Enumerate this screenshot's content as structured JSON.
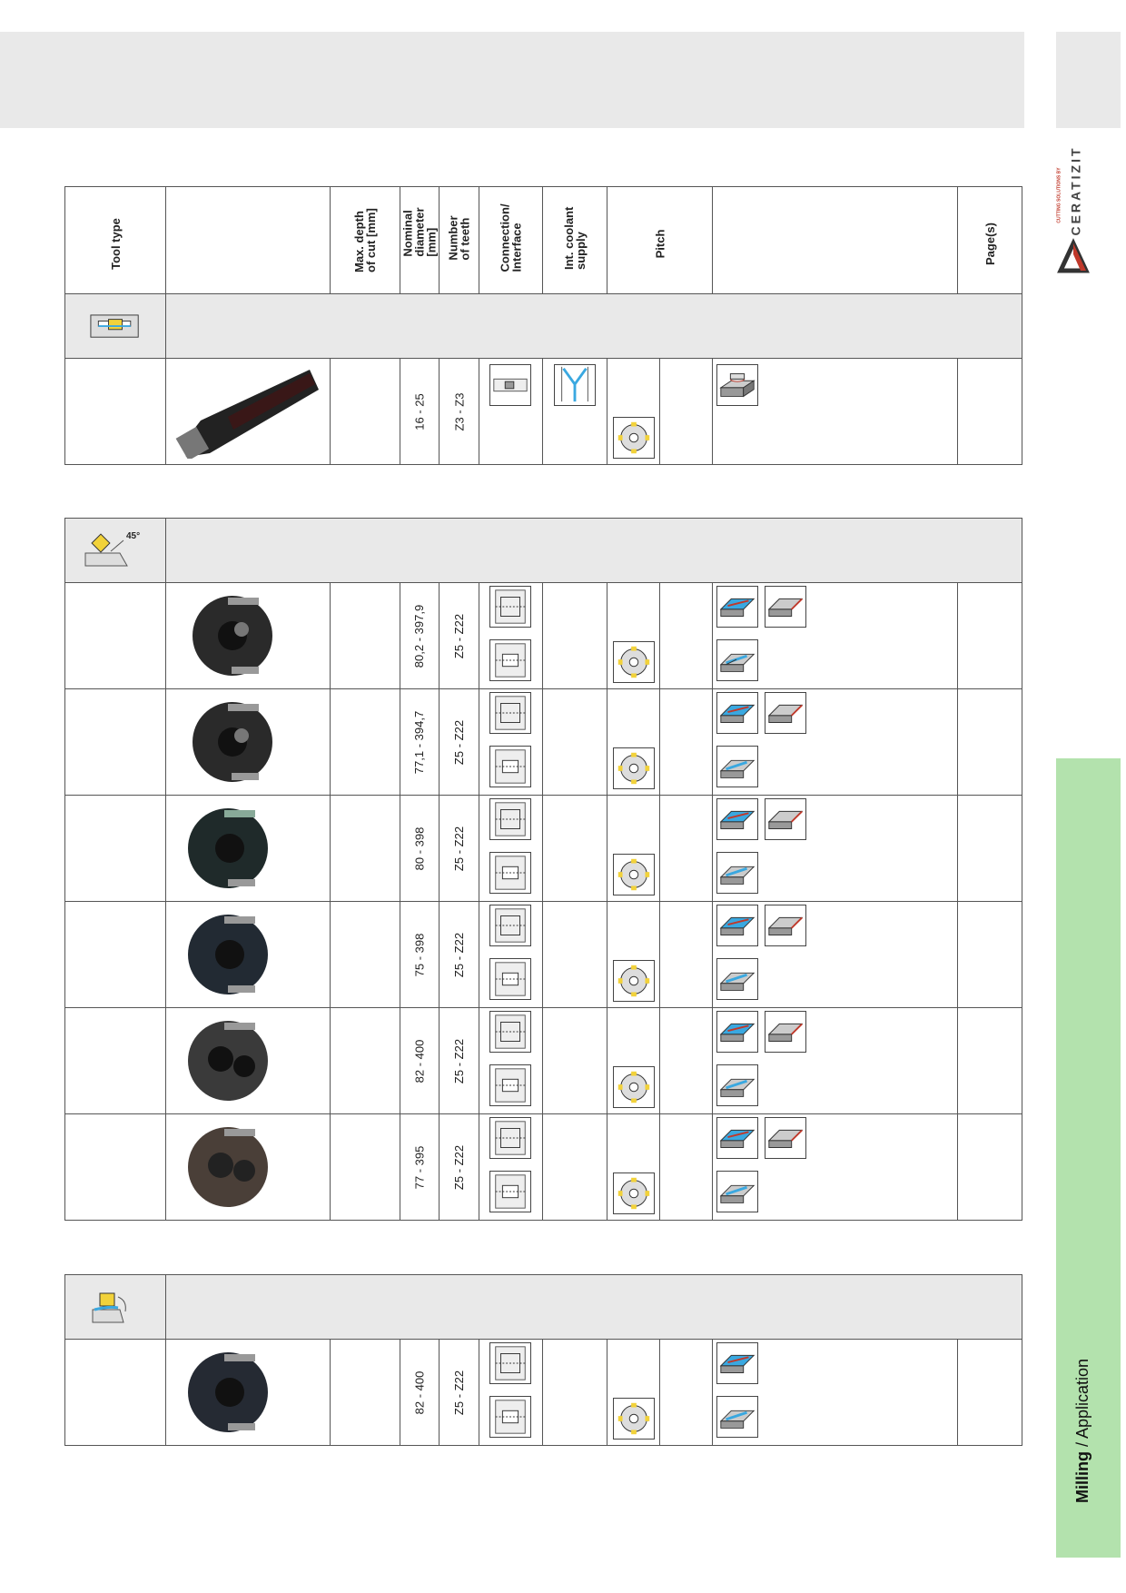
{
  "brand": {
    "name": "CERATIZIT",
    "tagline": "CUTTING SOLUTIONS BY"
  },
  "footer": {
    "bold": "Milling",
    "rest": " / Application"
  },
  "headers": {
    "tool_type": "Tool type",
    "max_depth": "Max. depth of cut [mm]",
    "nominal_diameter": "Nominal diameter [mm]",
    "teeth": "Number of teeth",
    "connection": "Connection/ Interface",
    "coolant": "Int. coolant supply",
    "pitch": "Pitch",
    "pages": "Page(s)"
  },
  "sections": [
    {
      "icon": "t-slot-insert-icon",
      "rows": [
        {
          "diameter": "16 - 25",
          "teeth": "Z3 - Z3",
          "image": "shank-cutter-photo"
        }
      ]
    },
    {
      "icon": "insert-45-degree-icon",
      "angle_label": "45°",
      "rows": [
        {
          "diameter": "80,2 - 397,9",
          "teeth": "Z5 - Z22",
          "image": "disc-cutter-photo"
        },
        {
          "diameter": "77,1 - 394,7",
          "teeth": "Z5 - Z22",
          "image": "disc-cutter-photo"
        },
        {
          "diameter": "80 - 398",
          "teeth": "Z5 - Z22",
          "image": "disc-cutter-photo"
        },
        {
          "diameter": "75 - 398",
          "teeth": "Z5 - Z22",
          "image": "disc-cutter-photo"
        },
        {
          "diameter": "82 - 400",
          "teeth": "Z5 - Z22",
          "image": "disc-cutter-photo"
        },
        {
          "diameter": "77 - 395",
          "teeth": "Z5 - Z22",
          "image": "disc-cutter-photo"
        }
      ]
    },
    {
      "icon": "insert-angle-icon",
      "rows": [
        {
          "diameter": "82 - 400",
          "teeth": "Z5 - Z22",
          "image": "disc-cutter-photo"
        }
      ]
    }
  ],
  "colors": {
    "section_gray": "#e9e9e9",
    "side_green": "#b3e2ad",
    "application_blue": "#3aa8e0",
    "insert_yellow": "#f2d23a"
  }
}
